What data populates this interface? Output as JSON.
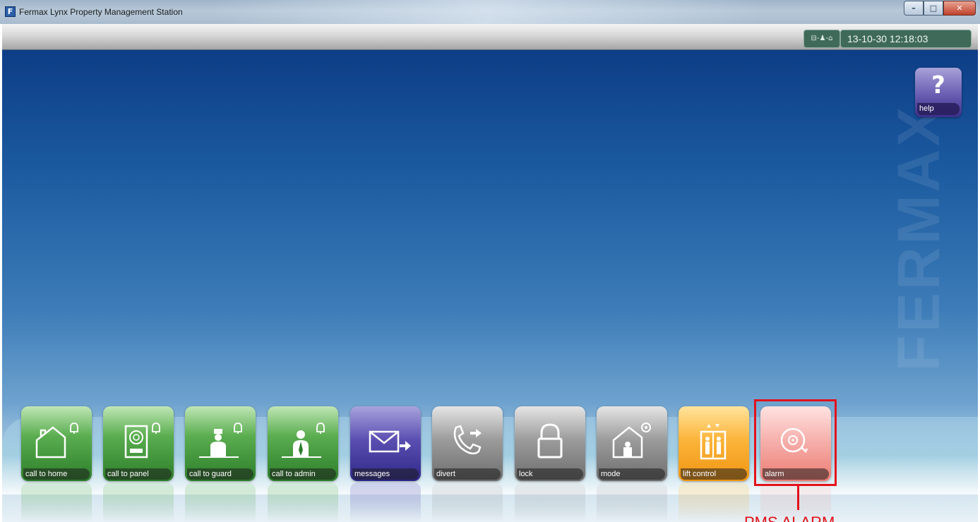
{
  "window": {
    "title": "Fermax Lynx Property Management Station",
    "app_icon_letter": "F",
    "controls": {
      "minimize": "–",
      "maximize": "□",
      "close": "✕"
    }
  },
  "status": {
    "network_indicator": "⊟-♟-⌂",
    "datetime": "13-10-30 12:18:03"
  },
  "watermark": "FERMAX",
  "help": {
    "label": "help",
    "glyph": "?"
  },
  "tiles": [
    {
      "label": "call to home",
      "color": "green",
      "icon": "house-bell-icon"
    },
    {
      "label": "call to panel",
      "color": "green",
      "icon": "panel-bell-icon"
    },
    {
      "label": "call to guard",
      "color": "green",
      "icon": "guard-bell-icon"
    },
    {
      "label": "call to admin",
      "color": "green",
      "icon": "admin-bell-icon"
    },
    {
      "label": "messages",
      "color": "purple",
      "icon": "envelope-arrow-icon"
    },
    {
      "label": "divert",
      "color": "gray",
      "icon": "phone-divert-icon"
    },
    {
      "label": "lock",
      "color": "gray",
      "icon": "padlock-icon"
    },
    {
      "label": "mode",
      "color": "gray",
      "icon": "house-gear-icon"
    },
    {
      "label": "lift control",
      "color": "orange",
      "icon": "lift-icon"
    },
    {
      "label": "alarm",
      "color": "pink",
      "icon": "alarm-bell-icon"
    }
  ],
  "annotation": {
    "text": "PMS ALARM",
    "color": "#e3111b"
  },
  "colors": {
    "green": "#4a9e42",
    "purple": "#4b41a6",
    "gray": "#8d8d8d",
    "orange": "#f7a623",
    "pink": "#f29b95",
    "background_top": "#0d3d86"
  }
}
